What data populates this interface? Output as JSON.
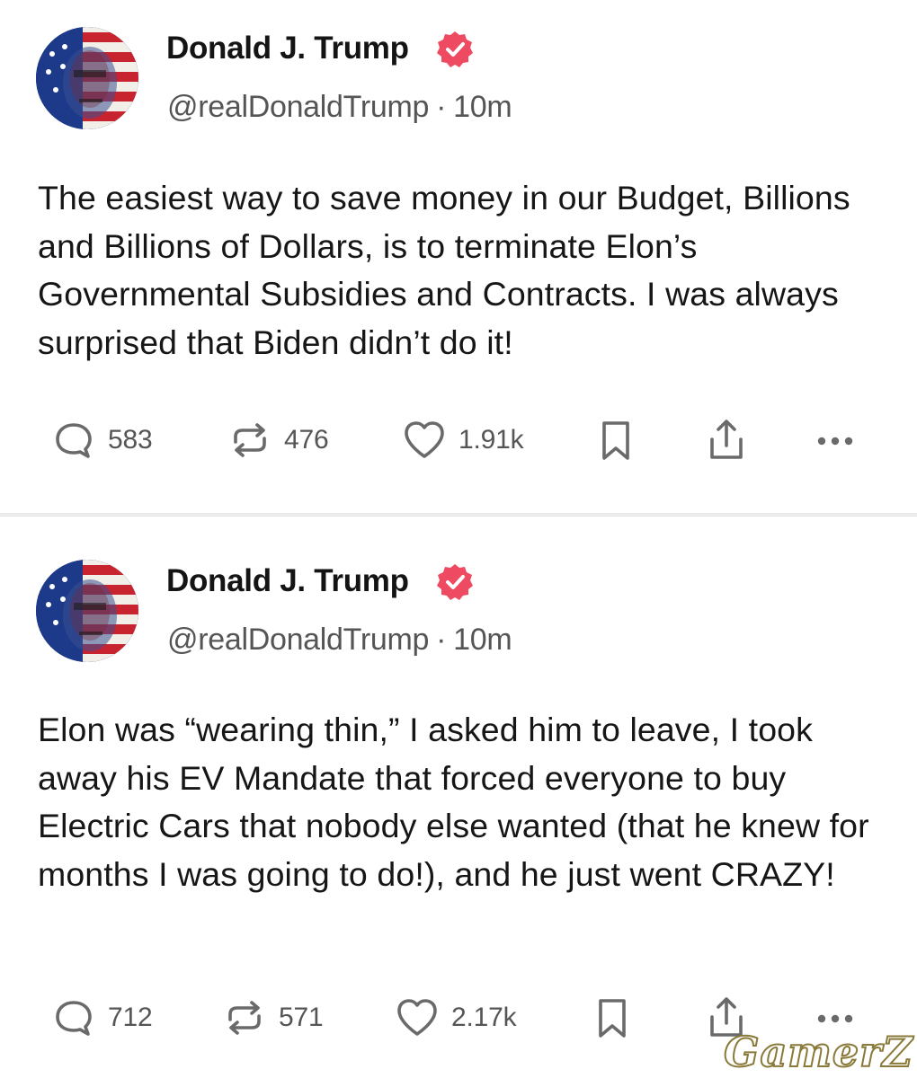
{
  "posts": [
    {
      "author": "Donald J. Trump",
      "handle": "@realDonaldTrump",
      "separator": "·",
      "time": "10m",
      "text": "The easiest way to save money in our Budget, Billions and Billions of Dollars, is to terminate Elon’s Governmental Subsidies and Contracts. I was always surprised that Biden didn’t do it!",
      "replies": "583",
      "reposts": "476",
      "likes": "1.91k"
    },
    {
      "author": "Donald J. Trump",
      "handle": "@realDonaldTrump",
      "separator": "·",
      "time": "10m",
      "text": "Elon was “wearing thin,” I asked him to leave, I took away his EV Mandate that forced everyone to buy Electric Cars that nobody else wanted (that he knew for months I was going to do!), and he just went CRAZY!",
      "replies": "712",
      "reposts": "571",
      "likes": "2.17k"
    }
  ],
  "watermark": "GamerZ",
  "colors": {
    "verified_badge": "#ee4a62",
    "icon_gray": "#6a6a6a",
    "text": "#161616",
    "secondary_text": "#555555"
  },
  "icons": [
    "reply-icon",
    "repost-icon",
    "like-icon",
    "bookmark-icon",
    "share-icon",
    "more-icon",
    "verified-badge-icon"
  ]
}
